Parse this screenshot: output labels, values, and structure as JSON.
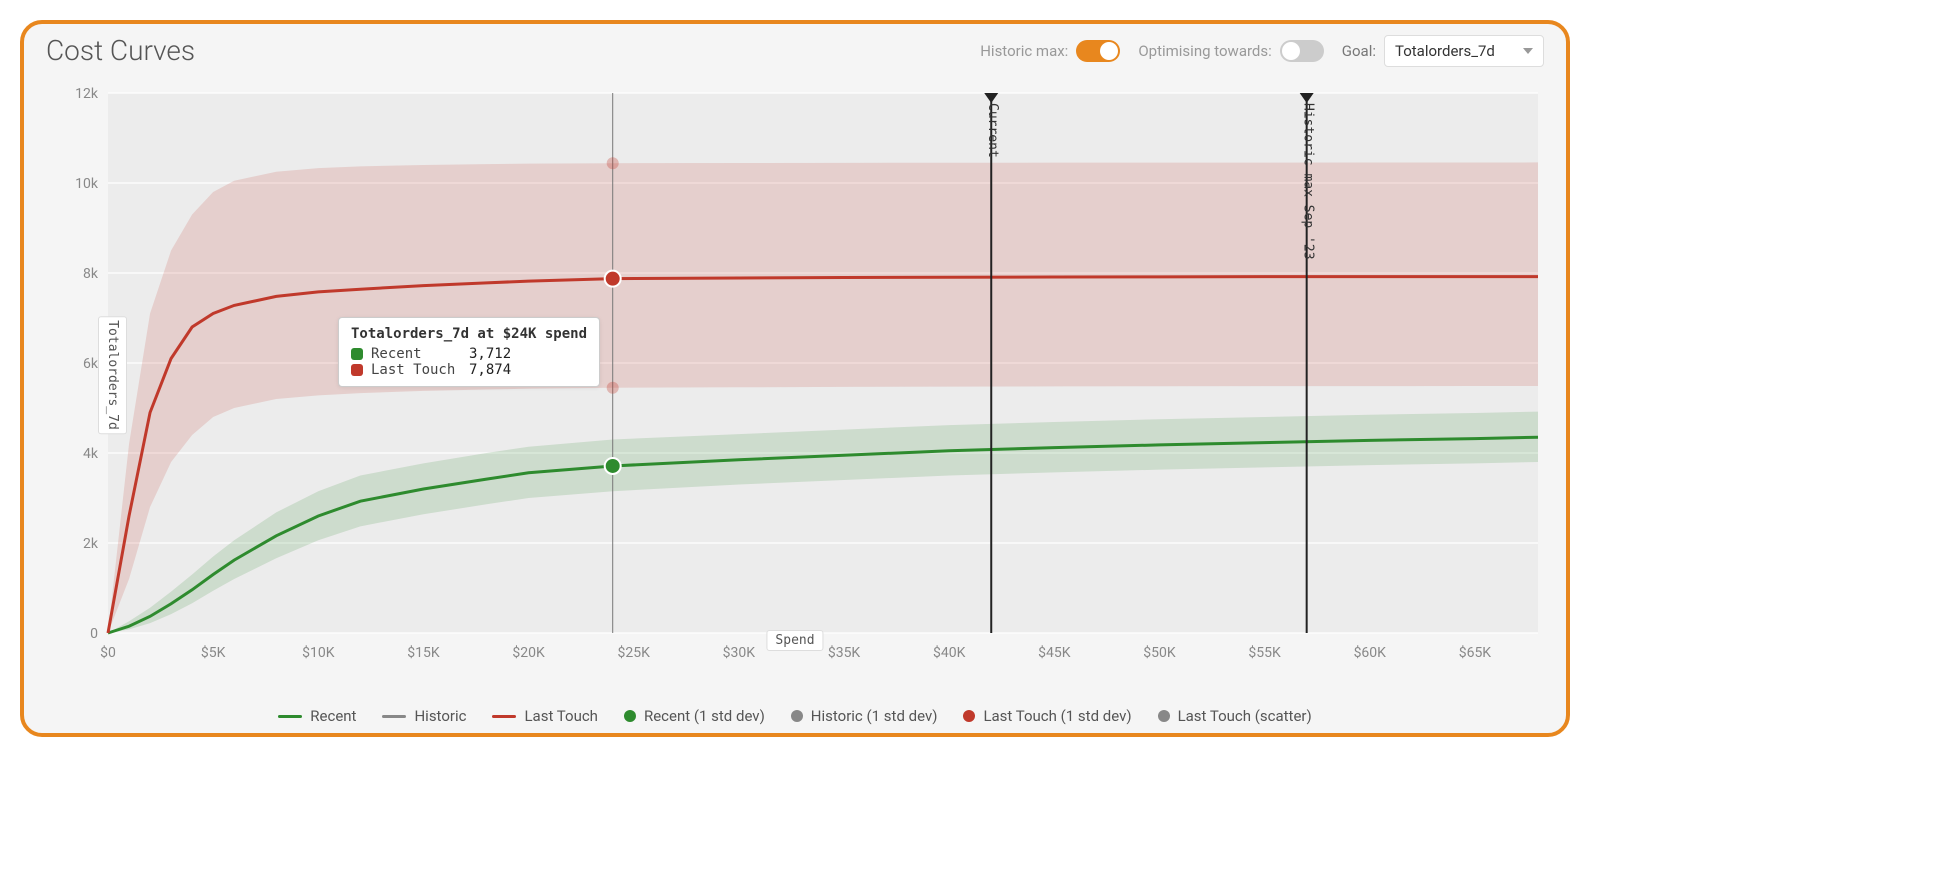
{
  "header": {
    "title": "Cost Curves",
    "historic_max_label": "Historic max:",
    "historic_max_on": true,
    "optimising_label": "Optimising towards:",
    "optimising_on": false,
    "goal_label": "Goal:",
    "goal_value": "Totalorders_7d"
  },
  "tooltip": {
    "title": "Totalorders_7d at $24K spend",
    "rows": [
      {
        "name": "Recent",
        "value": "3,712",
        "color": "#2e8b2e"
      },
      {
        "name": "Last Touch",
        "value": "7,874",
        "color": "#c0392b"
      }
    ]
  },
  "axes": {
    "ylabel": "Totalorders_7d",
    "xlabel": "Spend",
    "yticks": [
      "0",
      "2k",
      "4k",
      "6k",
      "8k",
      "10k",
      "12k"
    ],
    "xticks": [
      "$0",
      "$5K",
      "$10K",
      "$15K",
      "$20K",
      "$25K",
      "$30K",
      "$35K",
      "$40K",
      "$45K",
      "$50K",
      "$55K",
      "$60K",
      "$65K"
    ]
  },
  "markers": {
    "current": {
      "label": "Current",
      "x": 42000
    },
    "historic_max": {
      "label": "Historic max Sep '23",
      "x": 57000
    }
  },
  "legend": [
    {
      "kind": "line",
      "color": "#2e8b2e",
      "label": "Recent"
    },
    {
      "kind": "line",
      "color": "#888888",
      "label": "Historic"
    },
    {
      "kind": "line",
      "color": "#c0392b",
      "label": "Last Touch"
    },
    {
      "kind": "dot",
      "color": "#2e8b2e",
      "label": "Recent (1 std dev)"
    },
    {
      "kind": "dot",
      "color": "#888888",
      "label": "Historic (1 std dev)"
    },
    {
      "kind": "dot",
      "color": "#c0392b",
      "label": "Last Touch (1 std dev)"
    },
    {
      "kind": "dot",
      "color": "#888888",
      "label": "Last Touch (scatter)"
    }
  ],
  "chart_data": {
    "type": "line",
    "title": "Cost Curves",
    "xlabel": "Spend",
    "ylabel": "Totalorders_7d",
    "xlim": [
      0,
      68000
    ],
    "ylim": [
      0,
      12000
    ],
    "x": [
      0,
      1000,
      2000,
      3000,
      4000,
      5000,
      6000,
      8000,
      10000,
      12000,
      15000,
      18000,
      20000,
      24000,
      30000,
      35000,
      40000,
      45000,
      50000,
      55000,
      60000,
      65000,
      68000
    ],
    "series": [
      {
        "name": "Recent",
        "color": "#2e8b2e",
        "values": [
          0,
          150,
          370,
          650,
          960,
          1300,
          1620,
          2160,
          2600,
          2930,
          3200,
          3420,
          3560,
          3712,
          3850,
          3950,
          4050,
          4120,
          4180,
          4230,
          4280,
          4320,
          4350
        ]
      },
      {
        "name": "Last Touch",
        "color": "#c0392b",
        "values": [
          0,
          2600,
          4900,
          6100,
          6800,
          7100,
          7280,
          7480,
          7580,
          7640,
          7720,
          7780,
          7820,
          7874,
          7890,
          7900,
          7905,
          7910,
          7915,
          7920,
          7920,
          7920,
          7920
        ]
      }
    ],
    "bands": [
      {
        "name": "Recent (1 std dev)",
        "color": "#2e8b2e",
        "lower": [
          0,
          80,
          220,
          420,
          660,
          940,
          1200,
          1660,
          2060,
          2370,
          2640,
          2860,
          3000,
          3150,
          3300,
          3400,
          3500,
          3570,
          3630,
          3680,
          3730,
          3770,
          3800
        ],
        "upper": [
          0,
          260,
          560,
          920,
          1300,
          1700,
          2060,
          2680,
          3150,
          3500,
          3770,
          4000,
          4140,
          4300,
          4420,
          4520,
          4620,
          4690,
          4750,
          4800,
          4850,
          4890,
          4920
        ]
      },
      {
        "name": "Last Touch (1 std dev)",
        "color": "#c0392b",
        "lower": [
          0,
          1200,
          2800,
          3800,
          4400,
          4800,
          5000,
          5200,
          5280,
          5330,
          5380,
          5410,
          5430,
          5450,
          5460,
          5470,
          5475,
          5480,
          5483,
          5485,
          5487,
          5488,
          5490
        ],
        "upper": [
          0,
          4200,
          7100,
          8500,
          9300,
          9800,
          10050,
          10250,
          10330,
          10370,
          10400,
          10420,
          10430,
          10440,
          10445,
          10448,
          10450,
          10452,
          10453,
          10454,
          10455,
          10456,
          10457
        ]
      }
    ],
    "hover_x": 24000,
    "markers": [
      {
        "name": "Current",
        "x": 42000
      },
      {
        "name": "Historic max Sep '23",
        "x": 57000
      }
    ]
  }
}
